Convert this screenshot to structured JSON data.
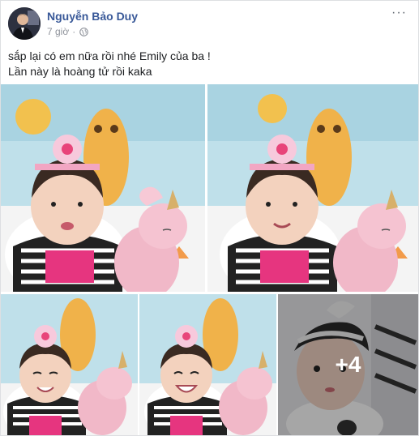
{
  "post": {
    "author": "Nguyễn Bảo Duy",
    "time": "7 giờ",
    "separator": "·",
    "privacy_icon": "globe-icon",
    "more_label": "···",
    "text_lines": [
      "sắp lại có em nữa rồi nhé Emily của ba !",
      "Lần này là hoàng tử rồi kaka"
    ],
    "photos": [
      {
        "name": "baby-photo-1",
        "tone": "#cfe6ee"
      },
      {
        "name": "baby-photo-2",
        "tone": "#cfe6ee"
      },
      {
        "name": "baby-photo-3",
        "tone": "#cfe6ee"
      },
      {
        "name": "baby-photo-4",
        "tone": "#cfe6ee"
      },
      {
        "name": "baby-photo-5",
        "tone": "#e8e8ea"
      }
    ],
    "more_photos_count": "+4"
  },
  "colors": {
    "author_link": "#385898",
    "meta_text": "#90949c",
    "body_text": "#1c1e21"
  }
}
